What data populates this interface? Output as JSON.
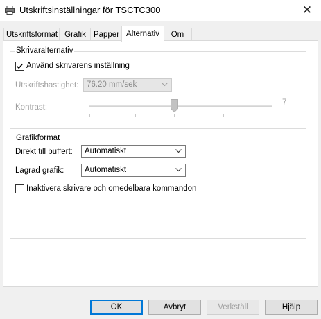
{
  "window": {
    "title": "Utskriftsinställningar för TSCTC300",
    "title_icon": "printer-icon",
    "close_glyph": "✕"
  },
  "tabs": [
    {
      "label": "Utskriftsformat",
      "active": false
    },
    {
      "label": "Grafik",
      "active": false
    },
    {
      "label": "Papper",
      "active": false
    },
    {
      "label": "Alternativ",
      "active": true
    },
    {
      "label": "Om",
      "active": false
    }
  ],
  "printer_options": {
    "group_label": "Skrivaralternativ",
    "use_printer_settings": {
      "label": "Använd skrivarens inställning",
      "checked": true
    },
    "print_speed": {
      "label": "Utskriftshastighet:",
      "value": "76.20 mm/sek",
      "enabled": false
    },
    "contrast": {
      "label": "Kontrast:",
      "value_text": "7",
      "level": 7,
      "min": 0,
      "max": 15,
      "enabled": false
    }
  },
  "graphics_format": {
    "group_label": "Grafikformat",
    "direct_to_buffer": {
      "label": "Direkt till buffert:",
      "value": "Automatiskt"
    },
    "stored_graphics": {
      "label": "Lagrad grafik:",
      "value": "Automatiskt"
    },
    "disable_printer": {
      "label": "Inaktivera skrivare och omedelbara kommandon",
      "checked": false
    }
  },
  "buttons": {
    "ok": "OK",
    "cancel": "Avbryt",
    "apply": "Verkställ",
    "help": "Hjälp"
  },
  "colors": {
    "accent": "#0078d7",
    "dialog_bg": "#f0f0f0",
    "disabled_text": "#a0a0a0"
  }
}
